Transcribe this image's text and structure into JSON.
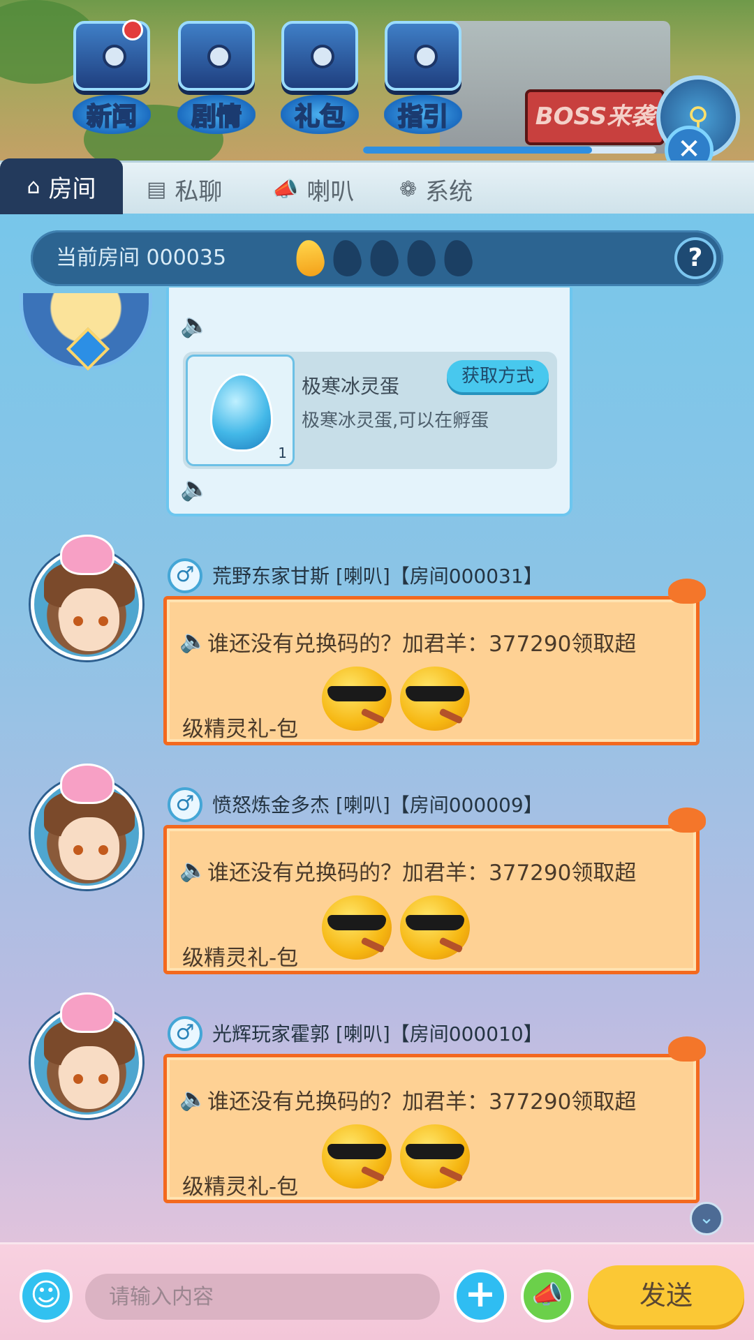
{
  "scene": {
    "shortcuts": [
      {
        "label": "新闻",
        "icon": "newspaper-icon",
        "badge": true
      },
      {
        "label": "剧情",
        "icon": "chest-icon",
        "badge": false
      },
      {
        "label": "礼包",
        "icon": "gift-icon",
        "badge": false
      },
      {
        "label": "指引",
        "icon": "guide-icon",
        "badge": false
      }
    ],
    "boss_banner": "BOSS来袭",
    "progress": 0.78
  },
  "tabs": [
    {
      "label": "房间",
      "icon": "home-icon",
      "active": true
    },
    {
      "label": "私聊",
      "icon": "chat-icon",
      "active": false
    },
    {
      "label": "喇叭",
      "icon": "megaphone-icon",
      "active": false
    },
    {
      "label": "系统",
      "icon": "flower-icon",
      "active": false
    }
  ],
  "room": {
    "label": "当前房间 000035",
    "heat_level": 1,
    "heat_max": 5,
    "help": "?"
  },
  "system_message": {
    "item_name": "极寒冰灵蛋",
    "item_desc": "极寒冰灵蛋,可以在孵蛋",
    "item_count": "1",
    "get_button": "获取方式"
  },
  "messages": [
    {
      "sender": "荒野东家甘斯 [喇叭]【房间000031】",
      "line1": "谁还没有兑换码的？加君羊：377290领取超",
      "line2": "级精灵礼-包"
    },
    {
      "sender": "愤怒炼金多杰 [喇叭]【房间000009】",
      "line1": "谁还没有兑换码的？加君羊：377290领取超",
      "line2": "级精灵礼-包"
    },
    {
      "sender": "光辉玩家霍郭 [喇叭]【房间000010】",
      "line1": "谁还没有兑换码的？加君羊：377290领取超",
      "line2": "级精灵礼-包"
    }
  ],
  "input": {
    "placeholder": "请输入内容",
    "send_label": "发送"
  },
  "colors": {
    "tab_active": "#233a5c",
    "bubble_fill": "#fed194",
    "bubble_border": "#f3691e",
    "send_button": "#fbc835"
  }
}
